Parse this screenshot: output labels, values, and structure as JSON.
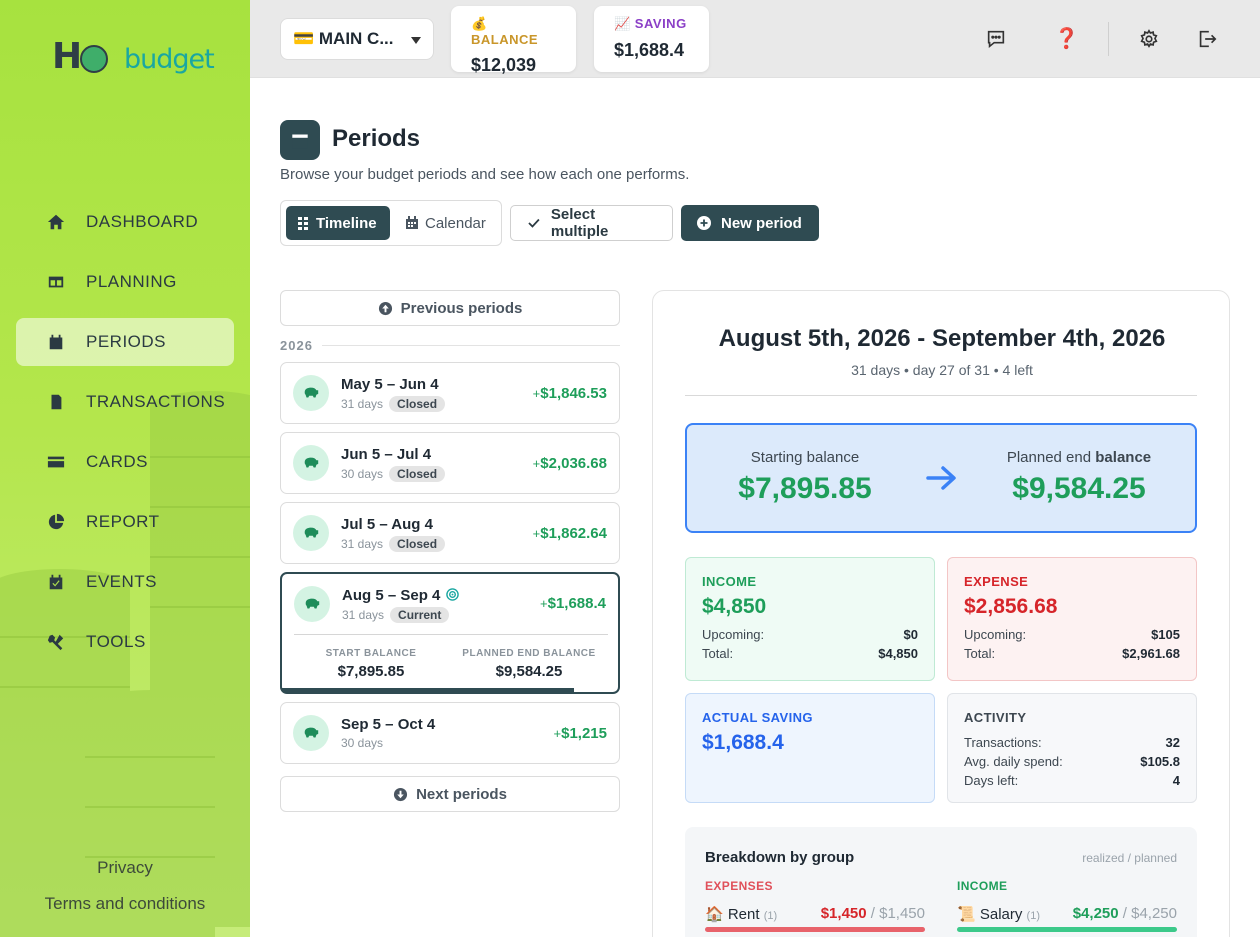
{
  "app": {
    "logo_hold": "H",
    "logo_budget": "budget"
  },
  "sidebar": {
    "items": [
      {
        "label": "DASHBOARD",
        "icon": "home-icon"
      },
      {
        "label": "PLANNING",
        "icon": "columns-icon"
      },
      {
        "label": "PERIODS",
        "icon": "calendar-icon",
        "active": true
      },
      {
        "label": "TRANSACTIONS",
        "icon": "receipt-icon"
      },
      {
        "label": "CARDS",
        "icon": "credit-card-icon"
      },
      {
        "label": "REPORT",
        "icon": "pie-chart-icon"
      },
      {
        "label": "EVENTS",
        "icon": "calendar-check-icon"
      },
      {
        "label": "TOOLS",
        "icon": "tools-icon"
      }
    ],
    "footer": {
      "privacy": "Privacy",
      "terms": "Terms and conditions"
    }
  },
  "header": {
    "card_select": "💳 MAIN C...",
    "balance_label": "💰 BALANCE",
    "balance_value": "$12,039",
    "saving_label": "📈 SAVING",
    "saving_value": "$1,688.4",
    "icons": [
      "chat-icon",
      "help-icon",
      "gear-icon",
      "logout-icon"
    ]
  },
  "page": {
    "title": "Periods",
    "subtitle": "Browse your budget periods and see how each one performs.",
    "view_timeline": "Timeline",
    "view_calendar": "Calendar",
    "select_multiple": "Select multiple",
    "new_period": "New period"
  },
  "list": {
    "previous": "Previous periods",
    "next": "Next periods",
    "year": "2026",
    "periods": [
      {
        "range": "May 5 – Jun 4",
        "days": "31 days",
        "status": "Closed",
        "amount": "$1,846.53"
      },
      {
        "range": "Jun 5 – Jul 4",
        "days": "30 days",
        "status": "Closed",
        "amount": "$2,036.68"
      },
      {
        "range": "Jul 5 – Aug 4",
        "days": "31 days",
        "status": "Closed",
        "amount": "$1,862.64"
      },
      {
        "range": "Aug 5 – Sep 4",
        "days": "31 days",
        "status": "Current",
        "amount": "$1,688.4",
        "start_label": "START BALANCE",
        "start_value": "$7,895.85",
        "end_label": "PLANNED END BALANCE",
        "end_value": "$9,584.25",
        "progress": 0.87
      },
      {
        "range": "Sep 5 – Oct 4",
        "days": "30 days",
        "status": "",
        "amount": "$1,215"
      }
    ],
    "plus": "+"
  },
  "detail": {
    "title": "August 5th, 2026 - September 4th, 2026",
    "subtitle": "31 days • day 27 of 31 • 4 left",
    "starting_label": "Starting balance",
    "starting_value": "$7,895.85",
    "planned_label_a": "Planned end ",
    "planned_label_b": "balance",
    "planned_value": "$9,584.25",
    "income": {
      "label": "INCOME",
      "value": "$4,850",
      "upcoming_label": "Upcoming:",
      "upcoming": "$0",
      "total_label": "Total:",
      "total": "$4,850"
    },
    "expense": {
      "label": "EXPENSE",
      "value": "$2,856.68",
      "upcoming_label": "Upcoming:",
      "upcoming": "$105",
      "total_label": "Total:",
      "total": "$2,961.68"
    },
    "saving": {
      "label": "ACTUAL SAVING",
      "value": "$1,688.4"
    },
    "activity": {
      "label": "ACTIVITY",
      "tx_label": "Transactions:",
      "tx": "32",
      "avg_label": "Avg. daily spend:",
      "avg": "$105.8",
      "days_label": "Days left:",
      "days": "4"
    },
    "breakdown": {
      "title": "Breakdown by group",
      "legend": "realized / planned",
      "expenses_head": "EXPENSES",
      "income_head": "INCOME",
      "expense_item": {
        "name": "🏠 Rent",
        "count": "(1)",
        "realized": "$1,450",
        "planned": "/ $1,450"
      },
      "income_item": {
        "name": "📜 Salary",
        "count": "(1)",
        "realized": "$4,250",
        "planned": "/ $4,250"
      }
    }
  },
  "colors": {
    "accent": "#2f4b52",
    "income": "#1e9e5a",
    "expense": "#d6252a",
    "saving": "#2563eb",
    "sidebar": "#a7e23f"
  }
}
